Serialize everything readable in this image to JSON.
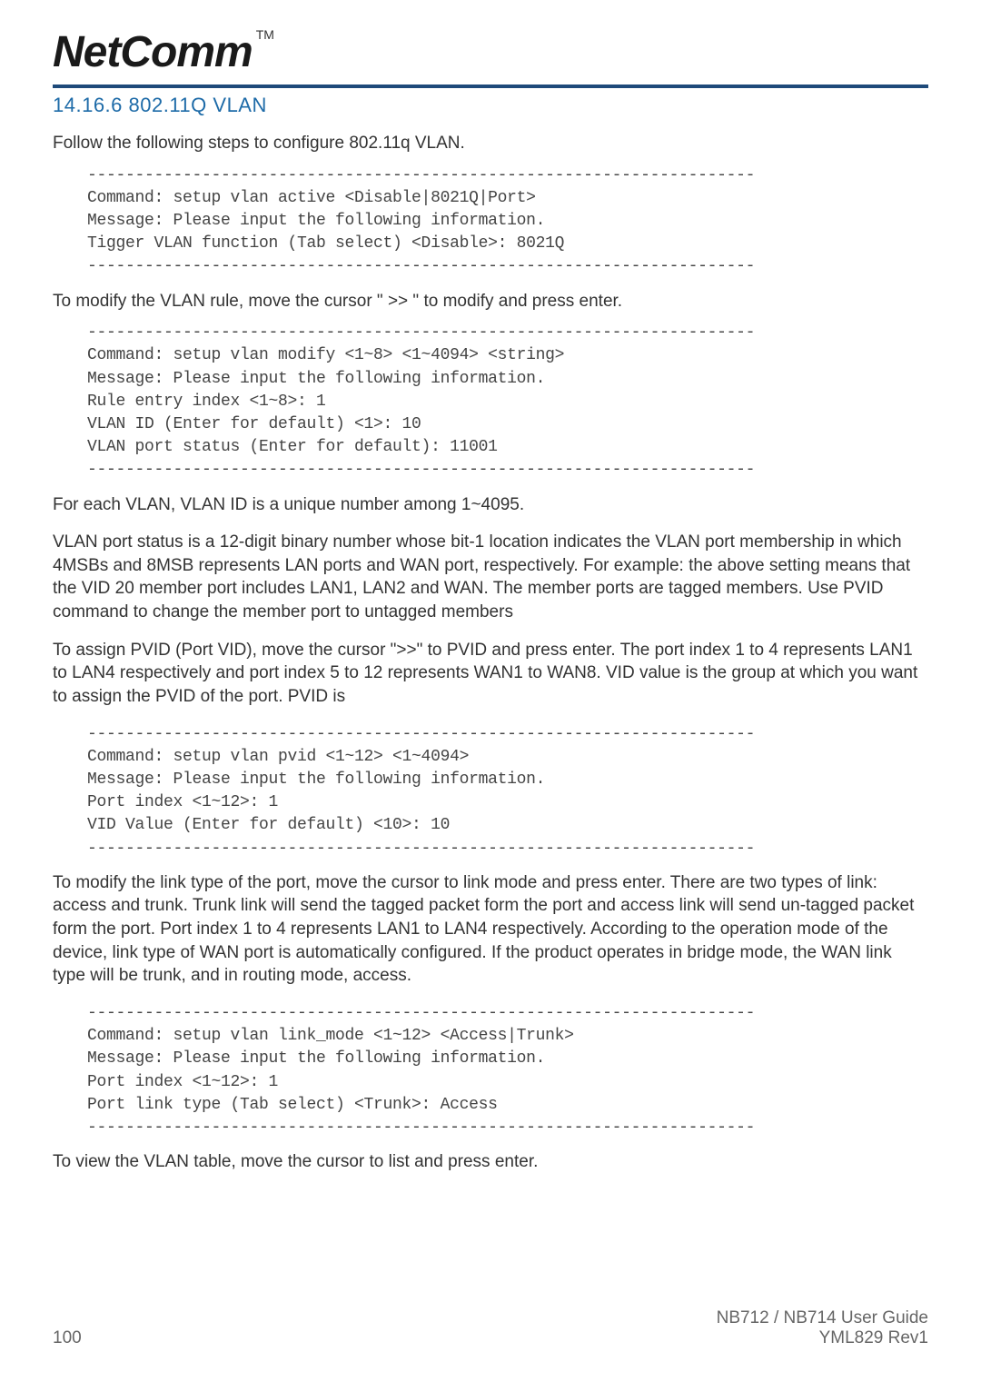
{
  "header": {
    "logo": "NetComm",
    "tm": "TM"
  },
  "section": {
    "heading": "14.16.6 802.11Q VLAN",
    "intro": "Follow the following steps to configure 802.11q VLAN."
  },
  "code1": "----------------------------------------------------------------------\nCommand: setup vlan active <Disable|8021Q|Port>\nMessage: Please input the following information.\nTigger VLAN function (Tab select) <Disable>: 8021Q\n----------------------------------------------------------------------",
  "text1": "To modify the VLAN rule, move the cursor \" >> \" to modify and press enter.",
  "code2": "----------------------------------------------------------------------\nCommand: setup vlan modify <1~8> <1~4094> <string>\nMessage: Please input the following information.\nRule entry index <1~8>: 1\nVLAN ID (Enter for default) <1>: 10\nVLAN port status (Enter for default): 11001\n----------------------------------------------------------------------",
  "text2": "For each VLAN, VLAN ID is a unique number among 1~4095.",
  "text3": "VLAN port status is a 12-digit binary number whose bit-1 location indicates the VLAN port membership in which 4MSBs and 8MSB represents LAN ports and WAN port, respectively. For example: the above setting means that the VID 20 member port includes LAN1, LAN2 and WAN. The member ports are tagged members. Use PVID command to change the member port to untagged members",
  "text4": "To assign PVID (Port VID), move the cursor \">>\" to PVID and press enter. The port index 1 to 4 represents LAN1 to LAN4 respectively and port index 5 to 12 represents WAN1 to WAN8. VID value is the group at which you want to assign the PVID of the port. PVID is",
  "code3": "----------------------------------------------------------------------\nCommand: setup vlan pvid <1~12> <1~4094>\nMessage: Please input the following information.\nPort index <1~12>: 1\nVID Value (Enter for default) <10>: 10\n----------------------------------------------------------------------",
  "text5": "To modify the link type of the port, move the cursor to link mode and press enter. There are two types of link: access and trunk. Trunk link will send the tagged packet form the port and access link will send un-tagged packet form the port. Port index 1 to 4 represents LAN1 to LAN4 respectively. According to the operation mode of the device, link type of WAN port is automatically configured. If the product operates in bridge mode, the WAN link type will be trunk, and in routing mode, access.",
  "code4": "----------------------------------------------------------------------\nCommand: setup vlan link_mode <1~12> <Access|Trunk>\nMessage: Please input the following information.\nPort index <1~12>: 1\nPort link type (Tab select) <Trunk>: Access\n----------------------------------------------------------------------",
  "text6": "To view the VLAN table, move the cursor to list and press enter.",
  "footer": {
    "page": "100",
    "guide": "NB712 / NB714 User Guide",
    "rev": "YML829 Rev1"
  }
}
